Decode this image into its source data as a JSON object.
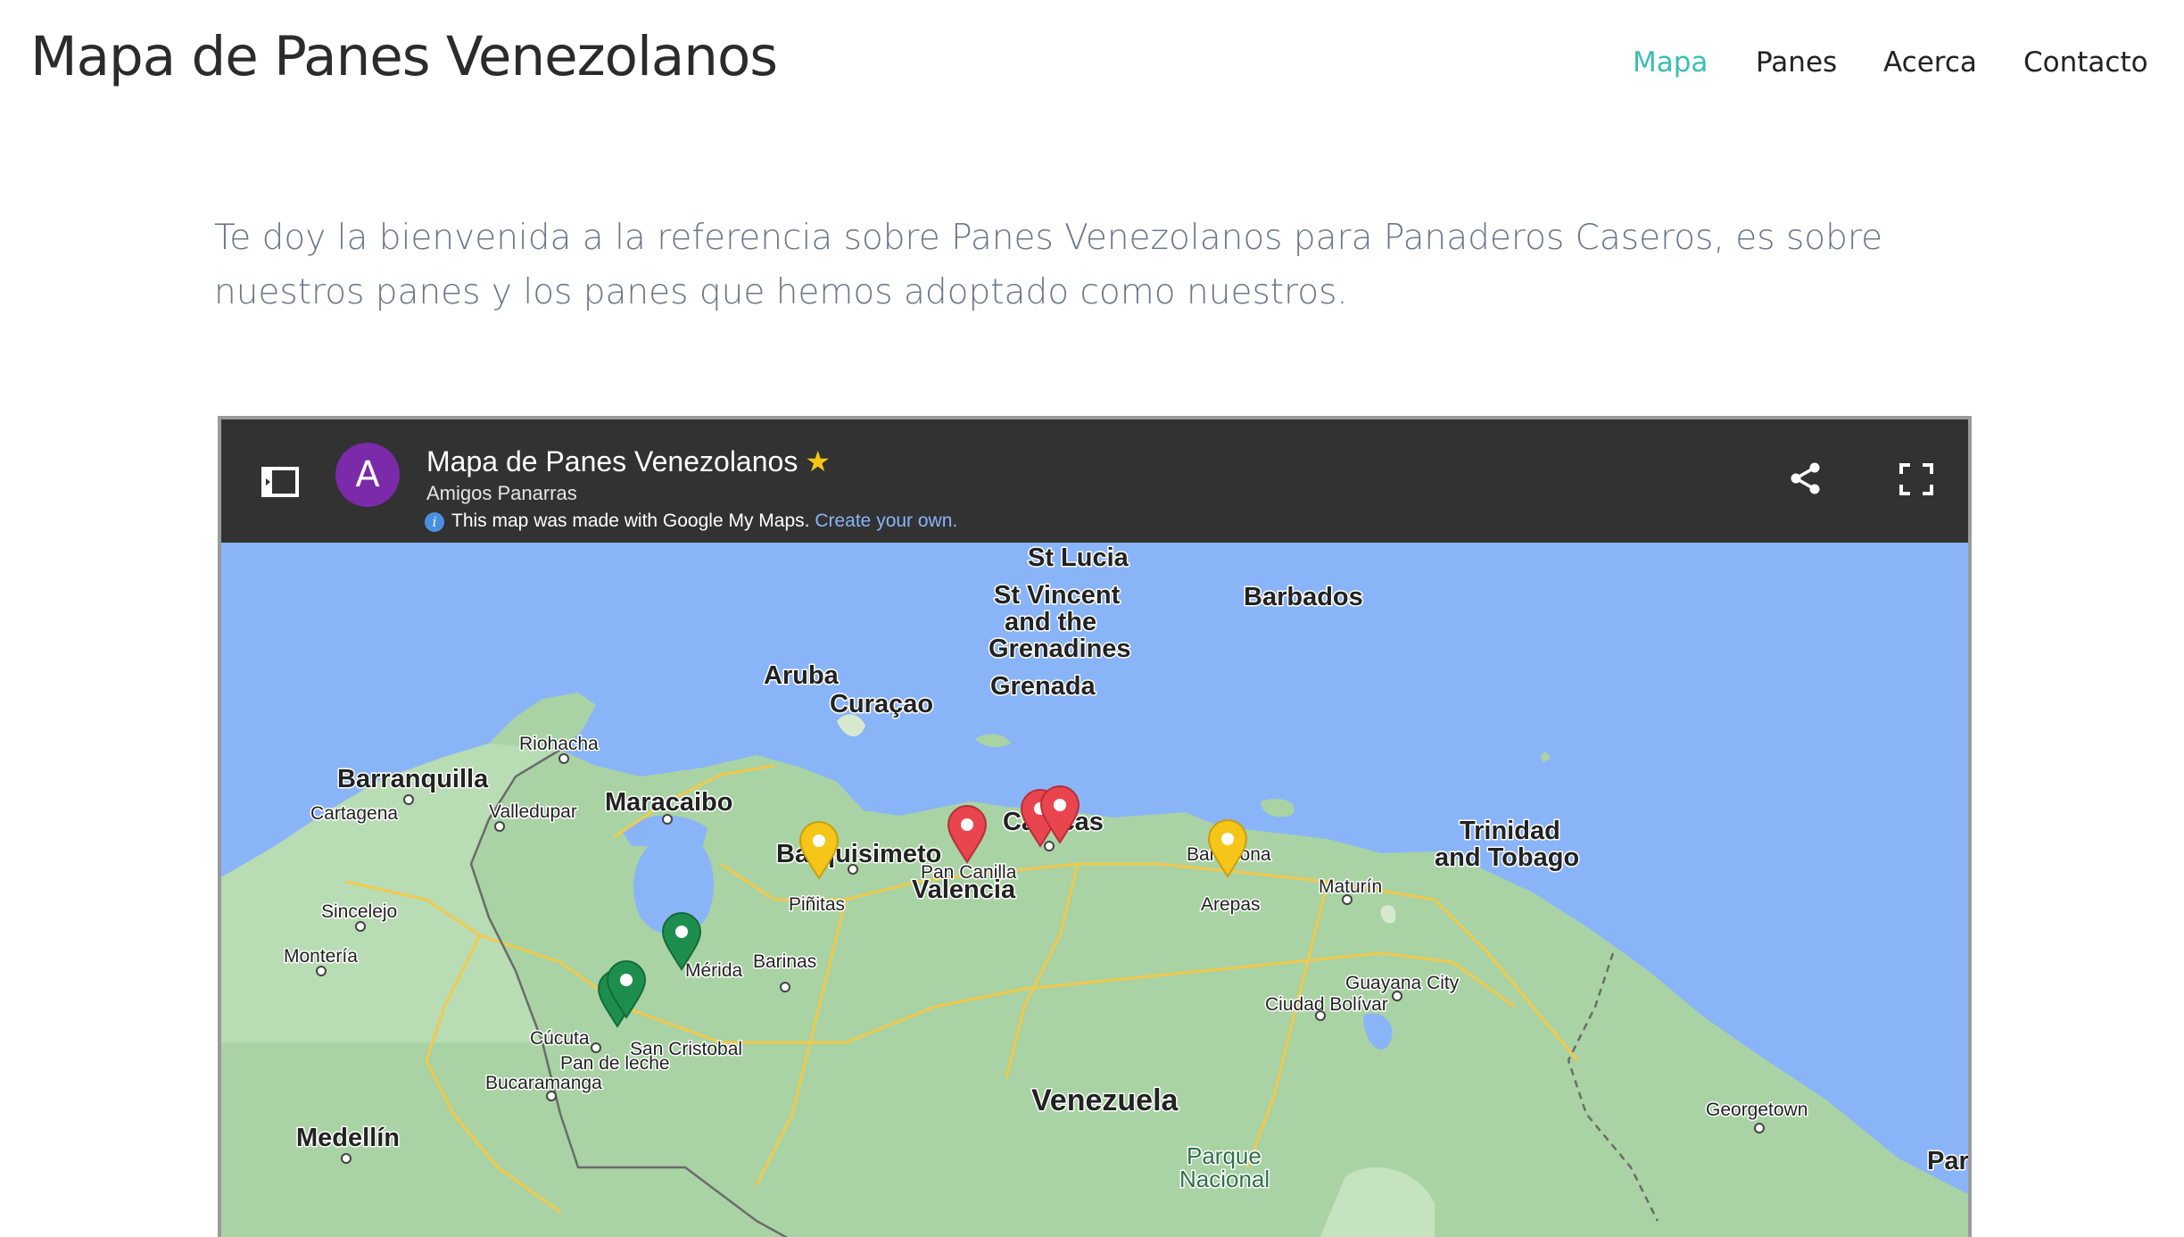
{
  "site": {
    "title": "Mapa de Panes Venezolanos",
    "nav": [
      {
        "label": "Mapa",
        "active": true
      },
      {
        "label": "Panes",
        "active": false
      },
      {
        "label": "Acerca",
        "active": false
      },
      {
        "label": "Contacto",
        "active": false
      }
    ]
  },
  "intro": {
    "text": "Te doy la bienvenida a la referencia sobre Panes Venezolanos para Panaderos Caseros, es sobre nuestros panes y los panes que hemos adoptado como nuestros."
  },
  "embed": {
    "avatar_letter": "A",
    "title": "Mapa de Panes Venezolanos",
    "star": "★",
    "owner": "Amigos Panarras",
    "info_text": "This map was made with Google My Maps.",
    "create_link": "Create your own.",
    "icons": {
      "legend_toggle": "sidebar-toggle-icon",
      "share": "share-icon",
      "fullscreen": "fullscreen-icon"
    }
  },
  "map": {
    "colors": {
      "water": "#8ab4f8",
      "land": "#a9d3a4",
      "roads": "#f2c94c"
    },
    "labels": {
      "st_lucia": "St Lucia",
      "st_vincent_1": "St Vincent",
      "st_vincent_2": "and the",
      "st_vincent_3": "Grenadines",
      "barbados": "Barbados",
      "grenada": "Grenada",
      "aruba": "Aruba",
      "curacao": "Curaçao",
      "riohacha": "Riohacha",
      "barranquilla": "Barranquilla",
      "maracaibo": "Maracaibo",
      "cartagena": "Cartagena",
      "valledupar": "Valledupar",
      "barquisimeto": "Barquisimeto",
      "caracas": "Caracas",
      "barcelona": "Barcelona",
      "trinidad_1": "Trinidad",
      "trinidad_2": "and Tobago",
      "pan_canilla": "Pan Canilla",
      "valencia": "Valencia",
      "pinitas": "Piñitas",
      "arepas": "Arepas",
      "maturin": "Maturín",
      "sincelejo": "Sincelejo",
      "monteria": "Montería",
      "merida": "Mérida",
      "barinas": "Barinas",
      "guayana": "Guayana City",
      "ciudad_bolivar": "Ciudad Bolívar",
      "cucuta": "Cúcuta",
      "san_cristobal": "San Cristobal",
      "pan_de_leche": "Pan de leche",
      "bucaramanga": "Bucaramanga",
      "venezuela": "Venezuela",
      "georgetown": "Georgetown",
      "medellin": "Medellín",
      "parque_1": "Parque",
      "parque_2": "Nacional",
      "par": "Par"
    },
    "pins": [
      {
        "name": "Pan Canilla",
        "color": "#e8454f"
      },
      {
        "name": "Caracas",
        "color": "#e8454f"
      },
      {
        "name": "Piñitas",
        "color": "#f5c518"
      },
      {
        "name": "Arepas",
        "color": "#f5c518"
      },
      {
        "name": "Mérida",
        "color": "#1e8e4e"
      },
      {
        "name": "Pan de leche",
        "color": "#1e8e4e"
      }
    ]
  }
}
